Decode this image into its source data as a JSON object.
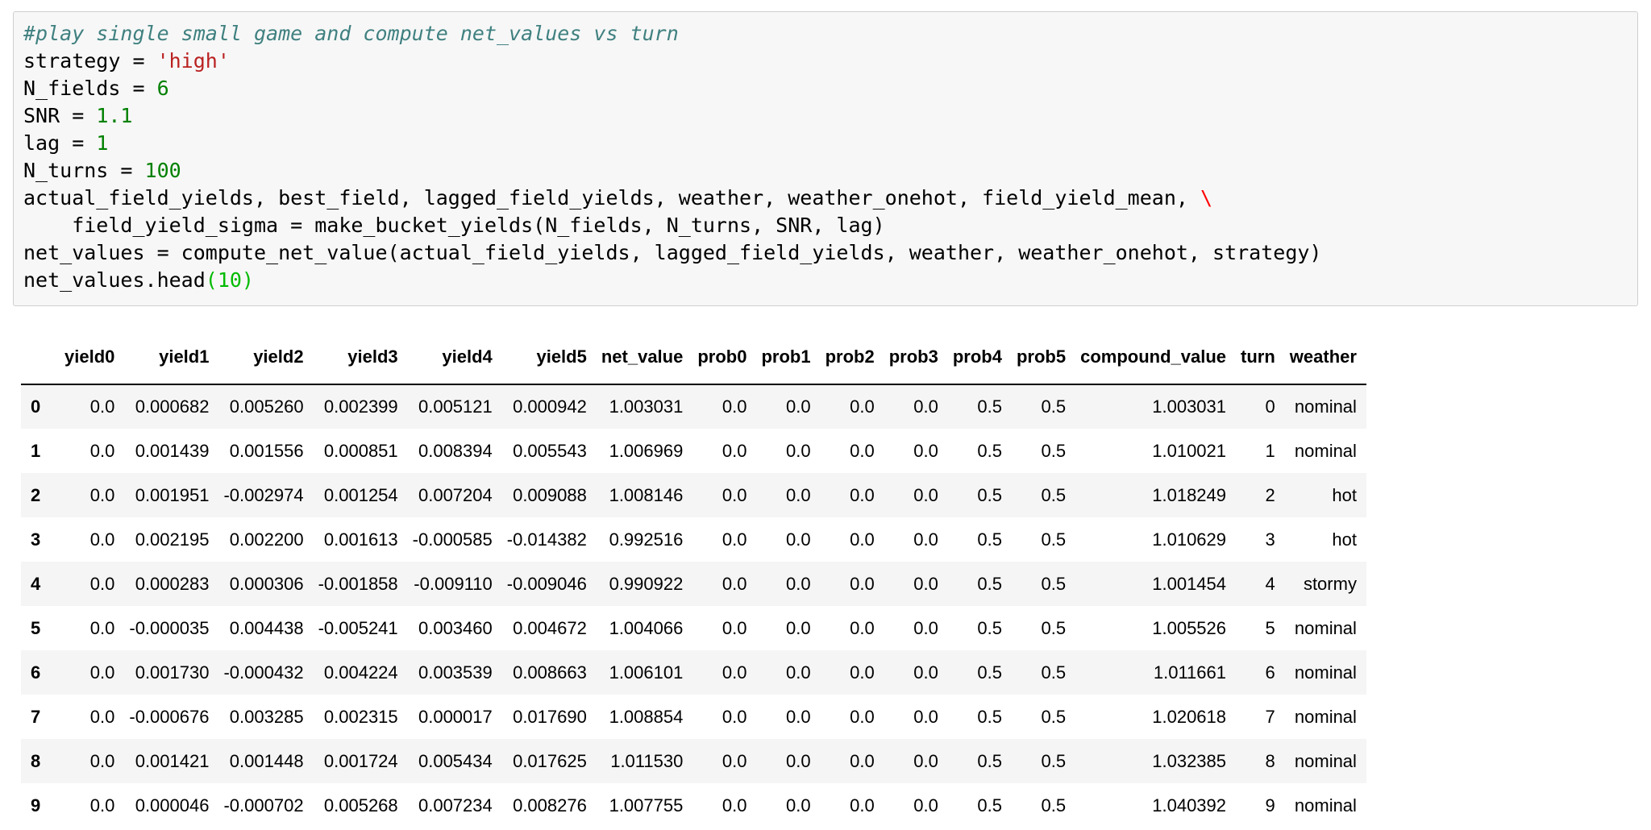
{
  "code_cell": {
    "lines": [
      {
        "parts": [
          {
            "t": "#play single small game and compute net_values vs turn",
            "c": "comment"
          }
        ]
      },
      {
        "parts": [
          {
            "t": "strategy = ",
            "c": ""
          },
          {
            "t": "'high'",
            "c": "str"
          }
        ]
      },
      {
        "parts": [
          {
            "t": "N_fields = ",
            "c": ""
          },
          {
            "t": "6",
            "c": "num"
          }
        ]
      },
      {
        "parts": [
          {
            "t": "SNR = ",
            "c": ""
          },
          {
            "t": "1.1",
            "c": "num"
          }
        ]
      },
      {
        "parts": [
          {
            "t": "lag = ",
            "c": ""
          },
          {
            "t": "1",
            "c": "num"
          }
        ]
      },
      {
        "parts": [
          {
            "t": "N_turns = ",
            "c": ""
          },
          {
            "t": "100",
            "c": "num"
          }
        ]
      },
      {
        "parts": [
          {
            "t": "actual_field_yields, best_field, lagged_field_yields, weather, weather_onehot, field_yield_mean, ",
            "c": ""
          },
          {
            "t": "\\",
            "c": "esc"
          }
        ]
      },
      {
        "parts": [
          {
            "t": "    field_yield_sigma = make_bucket_yields(N_fields, N_turns, SNR, lag)",
            "c": ""
          }
        ]
      },
      {
        "parts": [
          {
            "t": "net_values = compute_net_value(actual_field_yields, lagged_field_yields, weather, weather_onehot, strategy)",
            "c": ""
          }
        ]
      },
      {
        "parts": [
          {
            "t": "net_values.head",
            "c": ""
          },
          {
            "t": "(10)",
            "c": "paren"
          }
        ]
      }
    ]
  },
  "dataframe": {
    "columns": [
      "yield0",
      "yield1",
      "yield2",
      "yield3",
      "yield4",
      "yield5",
      "net_value",
      "prob0",
      "prob1",
      "prob2",
      "prob3",
      "prob4",
      "prob5",
      "compound_value",
      "turn",
      "weather"
    ],
    "rows": [
      {
        "index": "0",
        "cells": [
          "0.0",
          "0.000682",
          "0.005260",
          "0.002399",
          "0.005121",
          "0.000942",
          "1.003031",
          "0.0",
          "0.0",
          "0.0",
          "0.0",
          "0.5",
          "0.5",
          "1.003031",
          "0",
          "nominal"
        ]
      },
      {
        "index": "1",
        "cells": [
          "0.0",
          "0.001439",
          "0.001556",
          "0.000851",
          "0.008394",
          "0.005543",
          "1.006969",
          "0.0",
          "0.0",
          "0.0",
          "0.0",
          "0.5",
          "0.5",
          "1.010021",
          "1",
          "nominal"
        ]
      },
      {
        "index": "2",
        "cells": [
          "0.0",
          "0.001951",
          "-0.002974",
          "0.001254",
          "0.007204",
          "0.009088",
          "1.008146",
          "0.0",
          "0.0",
          "0.0",
          "0.0",
          "0.5",
          "0.5",
          "1.018249",
          "2",
          "hot"
        ]
      },
      {
        "index": "3",
        "cells": [
          "0.0",
          "0.002195",
          "0.002200",
          "0.001613",
          "-0.000585",
          "-0.014382",
          "0.992516",
          "0.0",
          "0.0",
          "0.0",
          "0.0",
          "0.5",
          "0.5",
          "1.010629",
          "3",
          "hot"
        ]
      },
      {
        "index": "4",
        "cells": [
          "0.0",
          "0.000283",
          "0.000306",
          "-0.001858",
          "-0.009110",
          "-0.009046",
          "0.990922",
          "0.0",
          "0.0",
          "0.0",
          "0.0",
          "0.5",
          "0.5",
          "1.001454",
          "4",
          "stormy"
        ]
      },
      {
        "index": "5",
        "cells": [
          "0.0",
          "-0.000035",
          "0.004438",
          "-0.005241",
          "0.003460",
          "0.004672",
          "1.004066",
          "0.0",
          "0.0",
          "0.0",
          "0.0",
          "0.5",
          "0.5",
          "1.005526",
          "5",
          "nominal"
        ]
      },
      {
        "index": "6",
        "cells": [
          "0.0",
          "0.001730",
          "-0.000432",
          "0.004224",
          "0.003539",
          "0.008663",
          "1.006101",
          "0.0",
          "0.0",
          "0.0",
          "0.0",
          "0.5",
          "0.5",
          "1.011661",
          "6",
          "nominal"
        ]
      },
      {
        "index": "7",
        "cells": [
          "0.0",
          "-0.000676",
          "0.003285",
          "0.002315",
          "0.000017",
          "0.017690",
          "1.008854",
          "0.0",
          "0.0",
          "0.0",
          "0.0",
          "0.5",
          "0.5",
          "1.020618",
          "7",
          "nominal"
        ]
      },
      {
        "index": "8",
        "cells": [
          "0.0",
          "0.001421",
          "0.001448",
          "0.001724",
          "0.005434",
          "0.017625",
          "1.011530",
          "0.0",
          "0.0",
          "0.0",
          "0.0",
          "0.5",
          "0.5",
          "1.032385",
          "8",
          "nominal"
        ]
      },
      {
        "index": "9",
        "cells": [
          "0.0",
          "0.000046",
          "-0.000702",
          "0.005268",
          "0.007234",
          "0.008276",
          "1.007755",
          "0.0",
          "0.0",
          "0.0",
          "0.0",
          "0.5",
          "0.5",
          "1.040392",
          "9",
          "nominal"
        ]
      }
    ]
  },
  "colors": {
    "comment": "#408080",
    "string": "#ba2121",
    "number": "#008000",
    "escape": "#ff0000",
    "paren": "#00bb00",
    "cell_bg": "#f7f7f7",
    "row_stripe": "#f5f5f5"
  }
}
